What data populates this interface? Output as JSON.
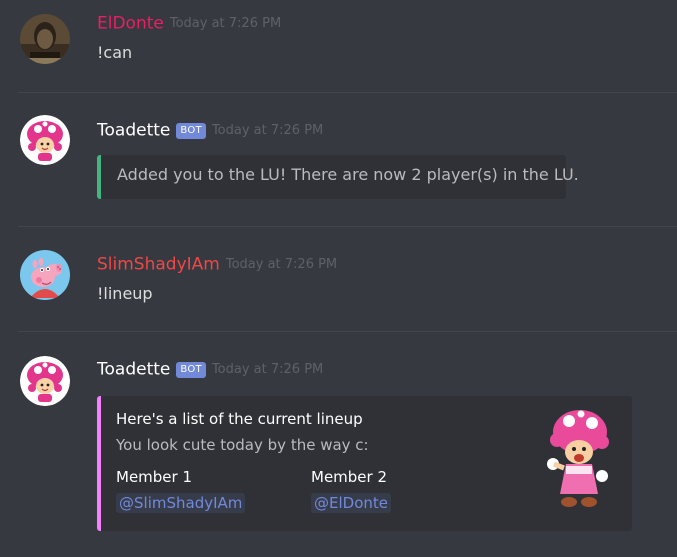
{
  "channel": {
    "messages": [
      {
        "author": "ElDonte",
        "author_color": "#e91e63",
        "timestamp": "Today at 7:26 PM",
        "text": "!can",
        "avatar_icon": "dark-portrait-avatar"
      },
      {
        "author": "Toadette",
        "author_color": "#ffffff",
        "bot_tag": "BOT",
        "timestamp": "Today at 7:26 PM",
        "avatar_icon": "toadette-avatar",
        "embed": {
          "accent_color": "#43b581",
          "description": "Added you to the LU! There are now 2 player(s) in the LU."
        }
      },
      {
        "author": "SlimShadyIAm",
        "author_color": "#f04747",
        "timestamp": "Today at 7:26 PM",
        "text": "!lineup",
        "avatar_icon": "peppa-pig-avatar"
      },
      {
        "author": "Toadette",
        "author_color": "#ffffff",
        "bot_tag": "BOT",
        "timestamp": "Today at 7:26 PM",
        "avatar_icon": "toadette-avatar",
        "embed": {
          "accent_color": "#f47fff",
          "title": "Here's a list of the current lineup",
          "description": "You look cute today by the way c:",
          "thumbnail_icon": "toadette-thumbnail",
          "fields": [
            {
              "name": "Member 1",
              "value": "@SlimShadyIAm"
            },
            {
              "name": "Member 2",
              "value": "@ElDonte"
            }
          ]
        }
      }
    ]
  }
}
